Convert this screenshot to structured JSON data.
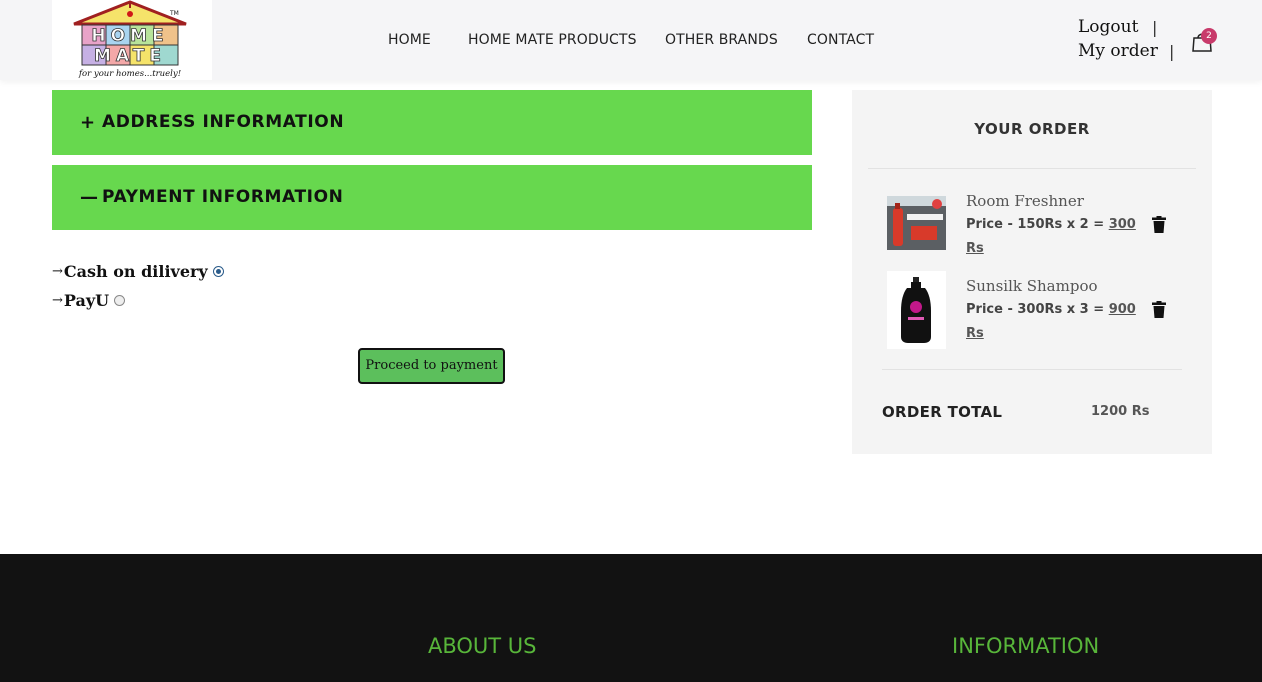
{
  "header": {
    "logo": {
      "name": "HOME MATE",
      "tagline": "for your homes...truely!",
      "top_text": "HOME",
      "bottom_text": "MATE",
      "tm": "TM"
    },
    "nav": [
      {
        "label": "HOME"
      },
      {
        "label": "HOME MATE PRODUCTS"
      },
      {
        "label": "OTHER BRANDS"
      },
      {
        "label": "CONTACT"
      }
    ],
    "logout_label": "Logout",
    "my_order_label": "My order",
    "separator": "|",
    "cart_count": "2"
  },
  "accordion": {
    "address": {
      "sign": "+",
      "title": "ADDRESS INFORMATION"
    },
    "payment": {
      "sign": "—",
      "title": "PAYMENT INFORMATION"
    }
  },
  "payment_options": [
    {
      "arrow": "→",
      "label": "Cash on dilivery",
      "selected": true
    },
    {
      "arrow": "→",
      "label": "PayU",
      "selected": false
    }
  ],
  "proceed_label": "Proceed to payment",
  "order": {
    "title": "YOUR ORDER",
    "items": [
      {
        "name": "Room Freshner",
        "price_text": "Price - 150Rs x 2 = ",
        "total": "300 Rs"
      },
      {
        "name": "Sunsilk Shampoo",
        "price_text": "Price - 300Rs x 3 = ",
        "total": "900 Rs"
      }
    ],
    "total_label": "ORDER TOTAL",
    "total_value": "1200 Rs"
  },
  "footer": {
    "about_title": "ABOUT US",
    "info_title": "INFORMATION"
  },
  "colors": {
    "accent_green": "#67d84e",
    "button_green": "#5cbf5c",
    "footer_bg": "#121212",
    "footer_heading": "#58b63a",
    "badge": "#c83a6b"
  }
}
